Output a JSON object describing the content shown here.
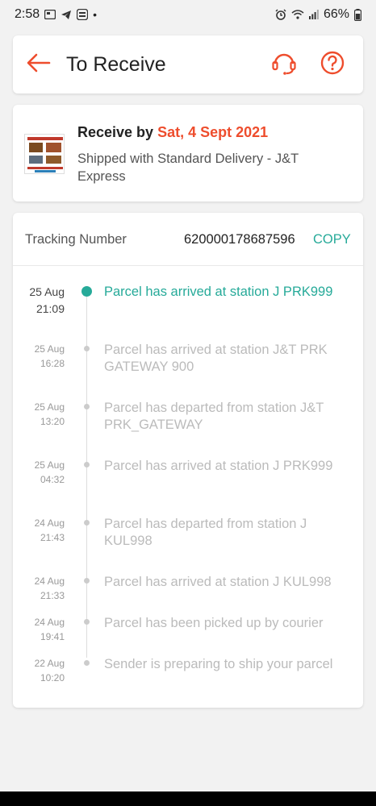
{
  "status_bar": {
    "time": "2:58",
    "dot": "•",
    "battery": "66%",
    "left_icons": [
      "gallery-icon",
      "telegram-icon",
      "app-icon"
    ],
    "right_icons": [
      "alarm-icon",
      "wifi-icon",
      "signal-icon",
      "battery-icon"
    ]
  },
  "header": {
    "title": "To Receive",
    "back_icon": "arrow-left-icon",
    "support_icon": "headset-icon",
    "help_icon": "question-circle-icon"
  },
  "delivery": {
    "receive_prefix": "Receive by ",
    "receive_date": "Sat, 4 Sept 2021",
    "shipping": "Shipped with Standard Delivery  - J&T Express"
  },
  "tracking": {
    "label": "Tracking Number",
    "number": "620000178687596",
    "copy_label": "COPY"
  },
  "events": [
    {
      "date": "25 Aug",
      "time": "21:09",
      "text": "Parcel has arrived at station J PRK999",
      "active": true
    },
    {
      "date": "25 Aug",
      "time": "16:28",
      "text": "Parcel has arrived at station J&T PRK GATEWAY 900",
      "active": false
    },
    {
      "date": "25 Aug",
      "time": "13:20",
      "text": "Parcel has departed from station J&T PRK_GATEWAY",
      "active": false
    },
    {
      "date": "25 Aug",
      "time": "04:32",
      "text": "Parcel has arrived at station J PRK999",
      "active": false
    },
    {
      "date": "24 Aug",
      "time": "21:43",
      "text": "Parcel has departed from station J KUL998",
      "active": false
    },
    {
      "date": "24 Aug",
      "time": "21:33",
      "text": "Parcel has arrived at station J KUL998",
      "active": false
    },
    {
      "date": "24 Aug",
      "time": "19:41",
      "text": "Parcel has been picked up by courier",
      "active": false
    },
    {
      "date": "22 Aug",
      "time": "10:20",
      "text": "Sender is preparing to ship your parcel",
      "active": false
    }
  ],
  "colors": {
    "accent": "#ee4d2d",
    "teal": "#26aa99",
    "muted": "#bbbbbb"
  }
}
